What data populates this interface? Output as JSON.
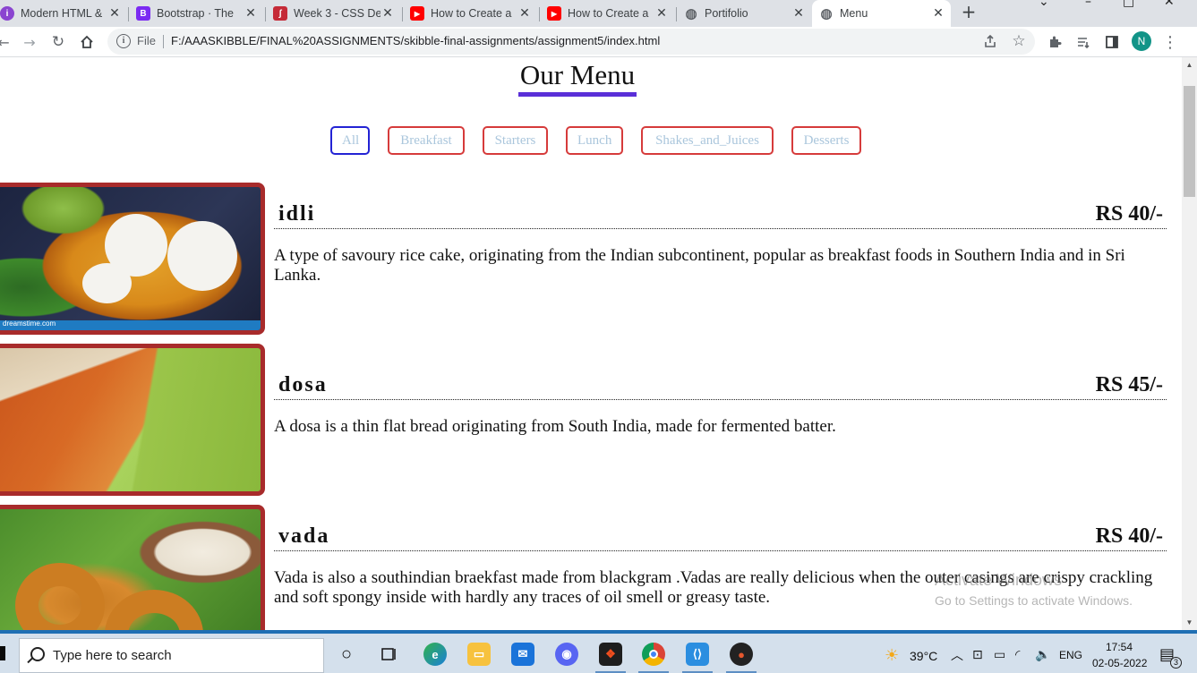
{
  "browser": {
    "tabs": [
      {
        "title": "Modern HTML &",
        "icon": "purple-circle-icon",
        "color": "#8a44d0",
        "glyph": "i"
      },
      {
        "title": "Bootstrap · The",
        "icon": "bootstrap-icon",
        "color": "#7b2bf2",
        "glyph": "B"
      },
      {
        "title": "Week 3 - CSS De",
        "icon": "skillshare-icon",
        "color": "#c52a37",
        "glyph": "ʃ"
      },
      {
        "title": "How to Create a",
        "icon": "youtube-icon",
        "color": "#ff0000",
        "glyph": "▶"
      },
      {
        "title": "How to Create a",
        "icon": "youtube-icon",
        "color": "#ff0000",
        "glyph": "▶"
      },
      {
        "title": "Portifolio",
        "icon": "globe-icon",
        "color": "#5f6368",
        "glyph": "◍"
      },
      {
        "title": "Menu",
        "icon": "globe-icon",
        "color": "#5f6368",
        "glyph": "◍"
      }
    ],
    "address": {
      "scheme_label": "File",
      "url": "F:/AAASKIBBLE/FINAL%20ASSIGNMENTS/skibble-final-assignments/assignment5/index.html"
    },
    "profile_initial": "N"
  },
  "page": {
    "title": "Our Menu",
    "filters": [
      "All",
      "Breakfast",
      "Starters",
      "Lunch",
      "Shakes_and_Juices",
      "Desserts"
    ],
    "active_filter": "All",
    "items": [
      {
        "name": "idli",
        "price": "RS 40/-",
        "description": "A type of savoury rice cake, originating from the Indian subcontinent, popular as breakfast foods in Southern India and in Sri Lanka.",
        "image_caption": "dreamstime.com"
      },
      {
        "name": "dosa",
        "price": "RS 45/-",
        "description": "A dosa is a thin flat bread originating from South India, made for fermented batter."
      },
      {
        "name": "vada",
        "price": "RS 40/-",
        "description": "Vada is also a southindian braekfast made from blackgram .Vadas are really delicious when the outer casings are crispy crackling and soft spongy inside with hardly any traces of oil smell or greasy taste."
      }
    ]
  },
  "watermark": {
    "line1": "Activate Windows",
    "line2": "Go to Settings to activate Windows."
  },
  "taskbar": {
    "search_placeholder": "Type here to search",
    "weather": "39°C",
    "language": "ENG",
    "time": "17:54",
    "date": "02-05-2022",
    "notification_count": "3"
  }
}
